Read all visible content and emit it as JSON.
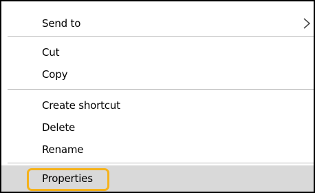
{
  "menu": {
    "items": [
      {
        "label": "Send to",
        "has_submenu": true,
        "submenu_icon": "chevron-right-icon"
      },
      {
        "label": "Cut"
      },
      {
        "label": "Copy"
      },
      {
        "label": "Create shortcut"
      },
      {
        "label": "Delete"
      },
      {
        "label": "Rename"
      },
      {
        "label": "Properties",
        "selected": true
      }
    ]
  },
  "colors": {
    "hover_background": "#d9d9d9",
    "highlight_outline": "#f5b21b",
    "separator": "#b8b8b8",
    "border": "#000000"
  }
}
